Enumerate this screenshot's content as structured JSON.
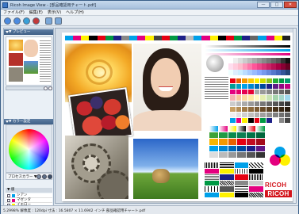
{
  "window": {
    "title": "Ricoh Image View - [部品確認用チャート.pdf]",
    "min": "—",
    "max": "□",
    "close": "✕"
  },
  "menu": [
    "ファイル(F)",
    "編集(E)",
    "表示(V)",
    "ヘルプ(H)"
  ],
  "toolbar": {
    "icons": [
      "open-icon",
      "save-icon",
      "color-icon",
      "settings-icon",
      "back-icon",
      "forward-icon"
    ],
    "colors": [
      "#4c8be0",
      "#4c8be0",
      "#39a0d9",
      "#c23a3a",
      "#7aa7d8",
      "#7aa7d8"
    ]
  },
  "panel": {
    "thumbnail_header": "▼ プレビュー",
    "color_header": "▼ カラー設定",
    "picker_label": "プロセスカラー ▼",
    "layer_header": "▼ 版"
  },
  "layers": [
    {
      "label": "シアン",
      "color": "#00a0e9"
    },
    {
      "label": "マゼンタ",
      "color": "#e4007f"
    },
    {
      "label": "イエロー",
      "color": "#fff100"
    },
    {
      "label": "ブラック",
      "color": "#000000"
    }
  ],
  "brand": {
    "ricoh_text": "RICOH",
    "ricoh_color": "#d3141b"
  },
  "status": {
    "text": "5.2998% 解像度 : 120dpi 寸法 : 16.5807 × 11.6942 インチ 部品確認用チャート.pdf"
  }
}
